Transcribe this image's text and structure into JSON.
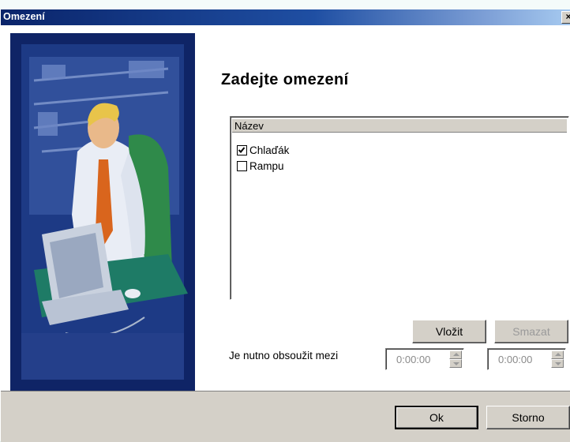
{
  "window": {
    "title": "Omezení",
    "close_glyph": "×"
  },
  "heading": "Zadejte omezení",
  "list": {
    "column_header": "Název",
    "items": [
      {
        "label": "Chlaďák",
        "checked": true
      },
      {
        "label": "Rampu",
        "checked": false
      }
    ]
  },
  "buttons": {
    "insert": "Vložit",
    "delete": "Smazat",
    "ok": "Ok",
    "cancel": "Storno"
  },
  "time_range": {
    "label": "Je nutno obsoužit mezi",
    "from": "0:00:00",
    "to": "0:00:00"
  },
  "colors": {
    "titlebar_start": "#0a246a",
    "dialog_face": "#d4d0c8",
    "art_background": "#0f2466"
  }
}
